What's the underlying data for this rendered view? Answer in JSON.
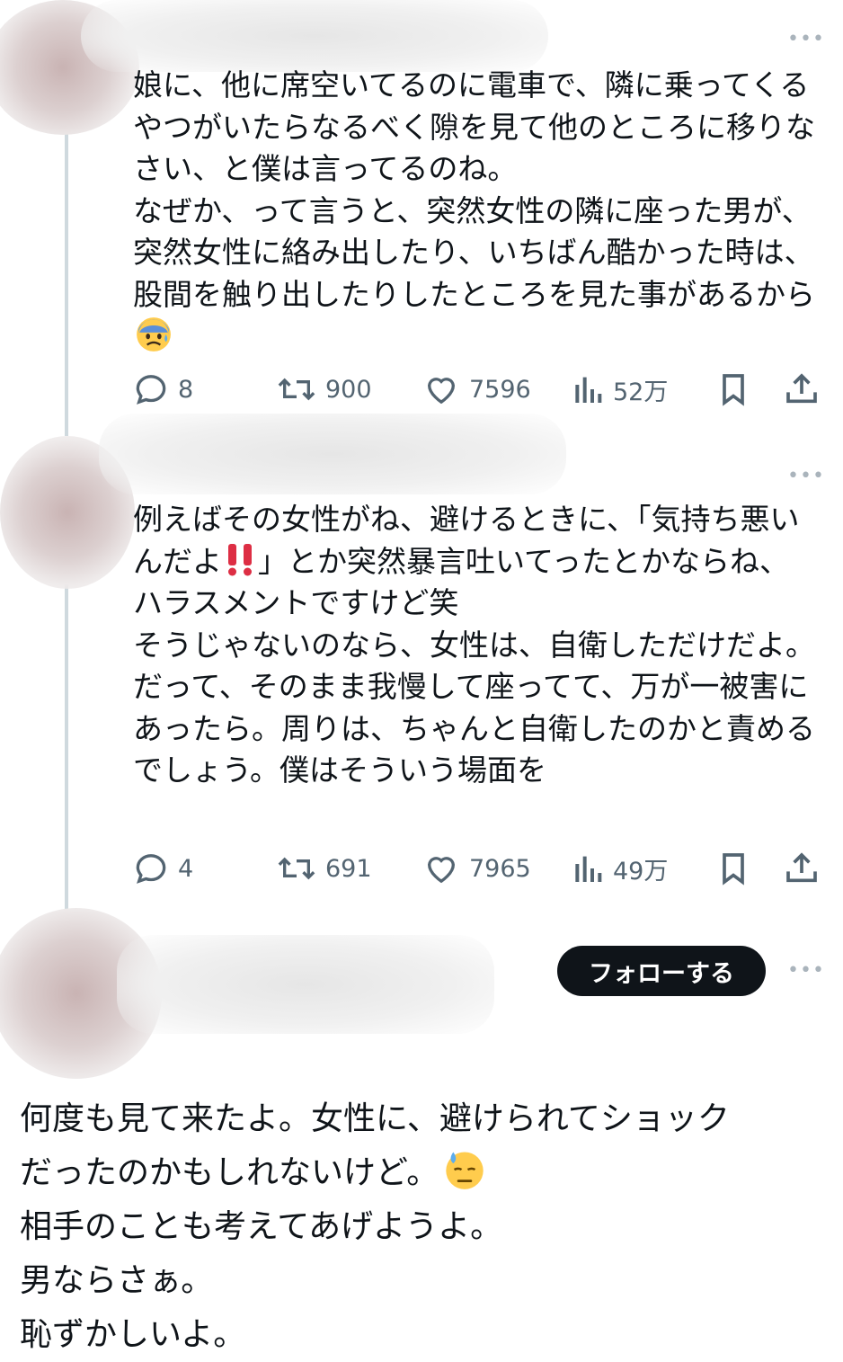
{
  "tweets": [
    {
      "text": "娘に、他に席空いてるのに電車で、隣に乗ってくるやつがいたらなるべく隙を見て他のところに移りなさい、と僕は言ってるのね。\nなぜか、って言うと、突然女性の隣に座った男が、突然女性に絡み出したり、いちばん酷かった時は、股間を触り出したりしたところを見た事があるから",
      "trailing_emoji": "anxious-face-with-sweat",
      "stats": {
        "replies": "8",
        "reposts": "900",
        "likes": "7596",
        "views": "52万"
      }
    },
    {
      "text_before_emoji": "例えばその女性がね、避けるときに、「気持ち悪いんだよ",
      "mid_emoji": "double-exclamation",
      "text_after_emoji": "」とか突然暴言吐いてったとかならね、ハラスメントですけど笑\nそうじゃないのなら、女性は、自衛しただけだよ。\nだって、そのまま我慢して座ってて、万が一被害にあったら。周りは、ちゃんと自衛したのかと責めるでしょう。僕はそういう場面を",
      "stats": {
        "replies": "4",
        "reposts": "691",
        "likes": "7965",
        "views": "49万"
      }
    }
  ],
  "reply": {
    "follow_label": "フォローする",
    "line1": "何度も見て来たよ。女性に、避けられてショック",
    "line2": "だったのかもしれないけど。",
    "line2_emoji": "downcast-face-with-sweat",
    "line3": "相手のことも考えてあげようよ。",
    "line4": "男ならさぁ。",
    "line5": "恥ずかしいよ。"
  },
  "icons": [
    "reply-icon",
    "repost-icon",
    "like-icon",
    "views-icon",
    "bookmark-icon",
    "share-icon",
    "more-icon"
  ],
  "colors": {
    "text": "#0f1419",
    "muted": "#536471",
    "thread_line": "#cfd9de",
    "follow_bg": "#0f1419"
  }
}
